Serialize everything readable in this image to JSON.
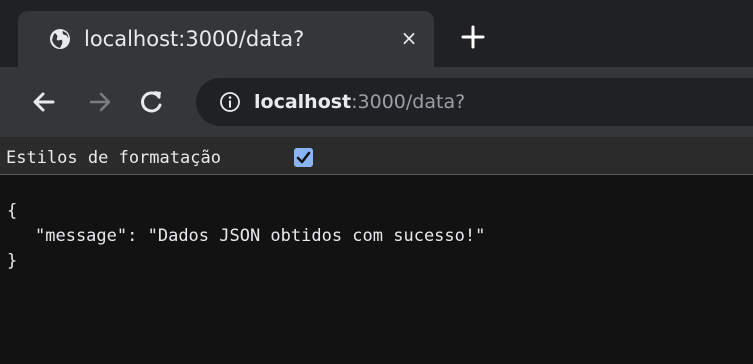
{
  "tab": {
    "title": "localhost:3000/data?",
    "favicon": "globe-icon",
    "close_glyph": "×"
  },
  "toolbar": {
    "url_host": "localhost",
    "url_rest": ":3000/data?"
  },
  "pretty_print": {
    "label": "Estilos de formatação",
    "checked": true
  },
  "json": {
    "open_brace": "{",
    "key": "\"message\"",
    "separator": ": ",
    "value": "\"Dados JSON obtidos com sucesso!\"",
    "close_brace": "}"
  },
  "colors": {
    "tabstrip": "#202124",
    "active_tab": "#35363a",
    "omnibox": "#202124",
    "page_bg": "#121212",
    "checkbox": "#8ab4f8"
  }
}
